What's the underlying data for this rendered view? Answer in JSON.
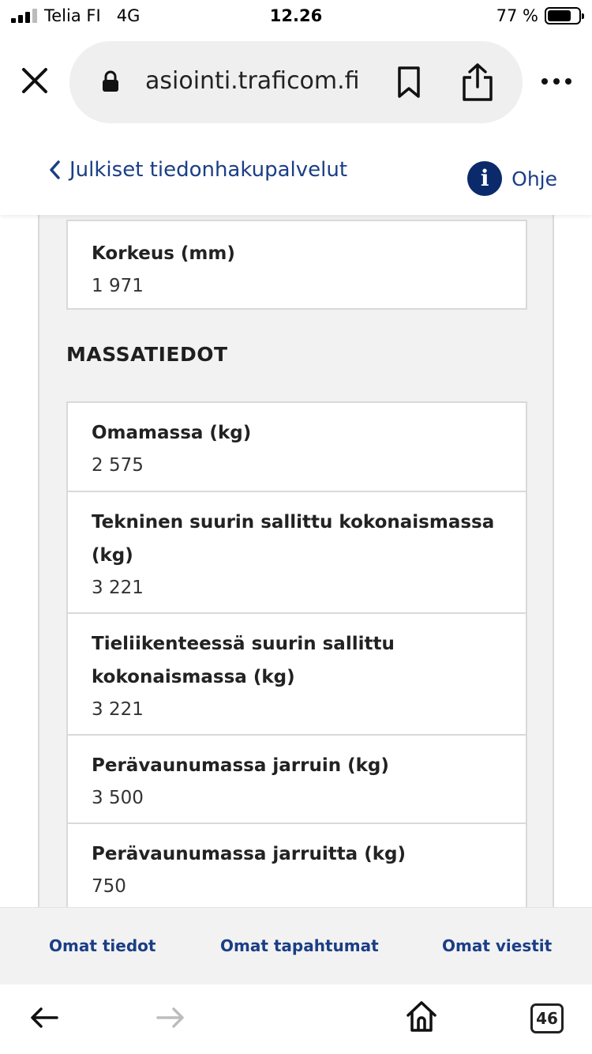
{
  "status_bar": {
    "carrier": "Telia FI",
    "network": "4G",
    "time": "12.26",
    "battery_percent": "77 %",
    "battery_level": 0.77
  },
  "browser": {
    "url": "asiointi.traficom.fi",
    "icons": [
      "close-icon",
      "lock-icon",
      "bookmark-icon",
      "share-icon",
      "more-icon"
    ]
  },
  "header": {
    "back_label": "Julkiset tiedonhakupalvelut",
    "help_label": "Ohje",
    "help_icon_glyph": "i"
  },
  "top_card": {
    "rows": [
      {
        "label": "Korkeus (mm)",
        "value": "1 971"
      }
    ]
  },
  "mass_section": {
    "title": "MASSATIEDOT",
    "rows": [
      {
        "label": "Omamassa (kg)",
        "value": "2 575"
      },
      {
        "label": "Tekninen suurin sallittu kokonaismassa (kg)",
        "value": "3 221"
      },
      {
        "label": "Tieliikenteessä suurin sallittu kokonaismassa (kg)",
        "value": "3 221"
      },
      {
        "label": "Perävaunumassa jarruin (kg)",
        "value": "3 500"
      },
      {
        "label": "Perävaunumassa jarruitta (kg)",
        "value": "750"
      }
    ]
  },
  "bottom_nav": {
    "own_info": "Omat tiedot",
    "own_events": "Omat tapahtumat",
    "own_messages": "Omat viestit"
  },
  "toolbar": {
    "tab_count": "46"
  },
  "colors": {
    "link_blue": "#1a3e86",
    "help_icon_bg": "#0a2a6b",
    "panel_bg": "#f2f2f2"
  }
}
